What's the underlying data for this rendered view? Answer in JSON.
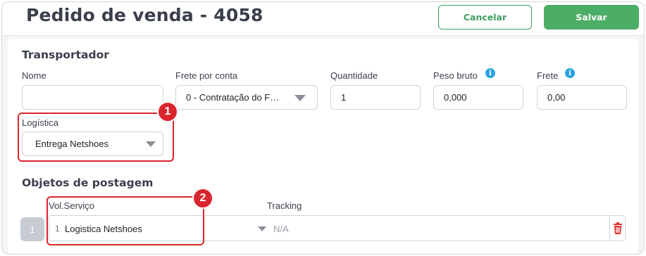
{
  "header": {
    "title": "Pedido de venda - 4058",
    "cancel_label": "Cancelar",
    "save_label": "Salvar"
  },
  "transportador": {
    "section_title": "Transportador",
    "nome": {
      "label": "Nome",
      "value": ""
    },
    "frete_por_conta": {
      "label": "Frete por conta",
      "value": "0 - Contratação do F…"
    },
    "quantidade": {
      "label": "Quantidade",
      "value": "1"
    },
    "peso_bruto": {
      "label": "Peso bruto",
      "value": "0,000",
      "info_icon": "info-icon"
    },
    "frete": {
      "label": "Frete",
      "value": "0,00",
      "info_icon": "info-icon"
    },
    "logistica": {
      "label": "Logística",
      "value": "Entrega Netshoes"
    }
  },
  "objetos": {
    "section_title": "Objetos de postagem",
    "col_vol_servico": "Vol.Serviço",
    "col_tracking": "Tracking",
    "rows": [
      {
        "index": "1",
        "vol": "1",
        "servico": "Logistica Netshoes",
        "tracking": "N/A"
      }
    ]
  },
  "annotations": {
    "badge_1": "1",
    "badge_2": "2",
    "color": "#d9262e"
  },
  "colors": {
    "primary_green": "#4cae66",
    "info_blue": "#2aa3e0",
    "delete_red": "#e0322d"
  }
}
